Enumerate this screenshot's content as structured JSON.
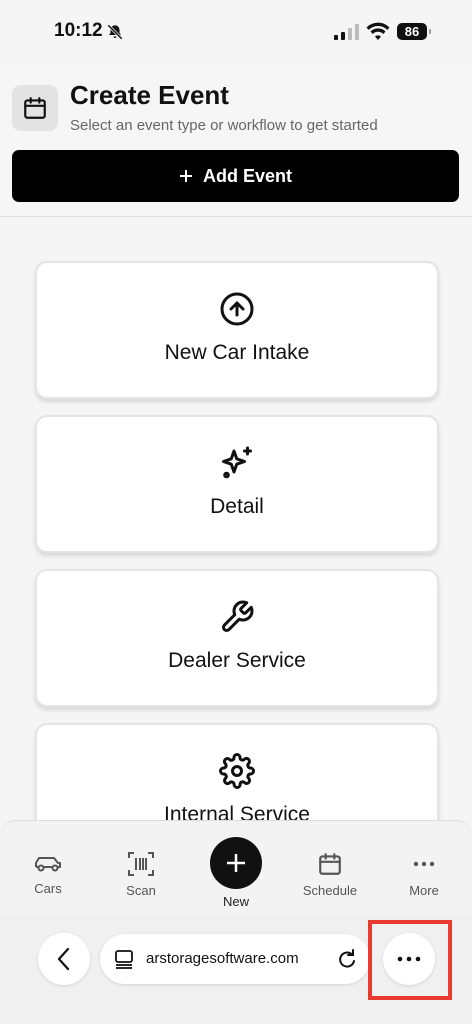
{
  "status": {
    "time": "10:12",
    "battery": "86"
  },
  "header": {
    "title": "Create Event",
    "subtitle": "Select an event type or workflow to get started",
    "add_button": "Add Event"
  },
  "event_types": [
    {
      "label": "New Car Intake",
      "icon": "arrow-up-circle-icon"
    },
    {
      "label": "Detail",
      "icon": "sparkles-icon"
    },
    {
      "label": "Dealer Service",
      "icon": "wrench-icon"
    },
    {
      "label": "Internal Service",
      "icon": "gear-icon"
    }
  ],
  "tabs": [
    {
      "label": "Cars",
      "icon": "car-icon"
    },
    {
      "label": "Scan",
      "icon": "barcode-scan-icon"
    },
    {
      "label": "New",
      "icon": "plus-icon"
    },
    {
      "label": "Schedule",
      "icon": "calendar-icon"
    },
    {
      "label": "More",
      "icon": "ellipsis-icon"
    }
  ],
  "browser": {
    "url": "arstoragesoftware.com"
  },
  "colors": {
    "highlight": "#e63b2e",
    "button": "#000000"
  }
}
